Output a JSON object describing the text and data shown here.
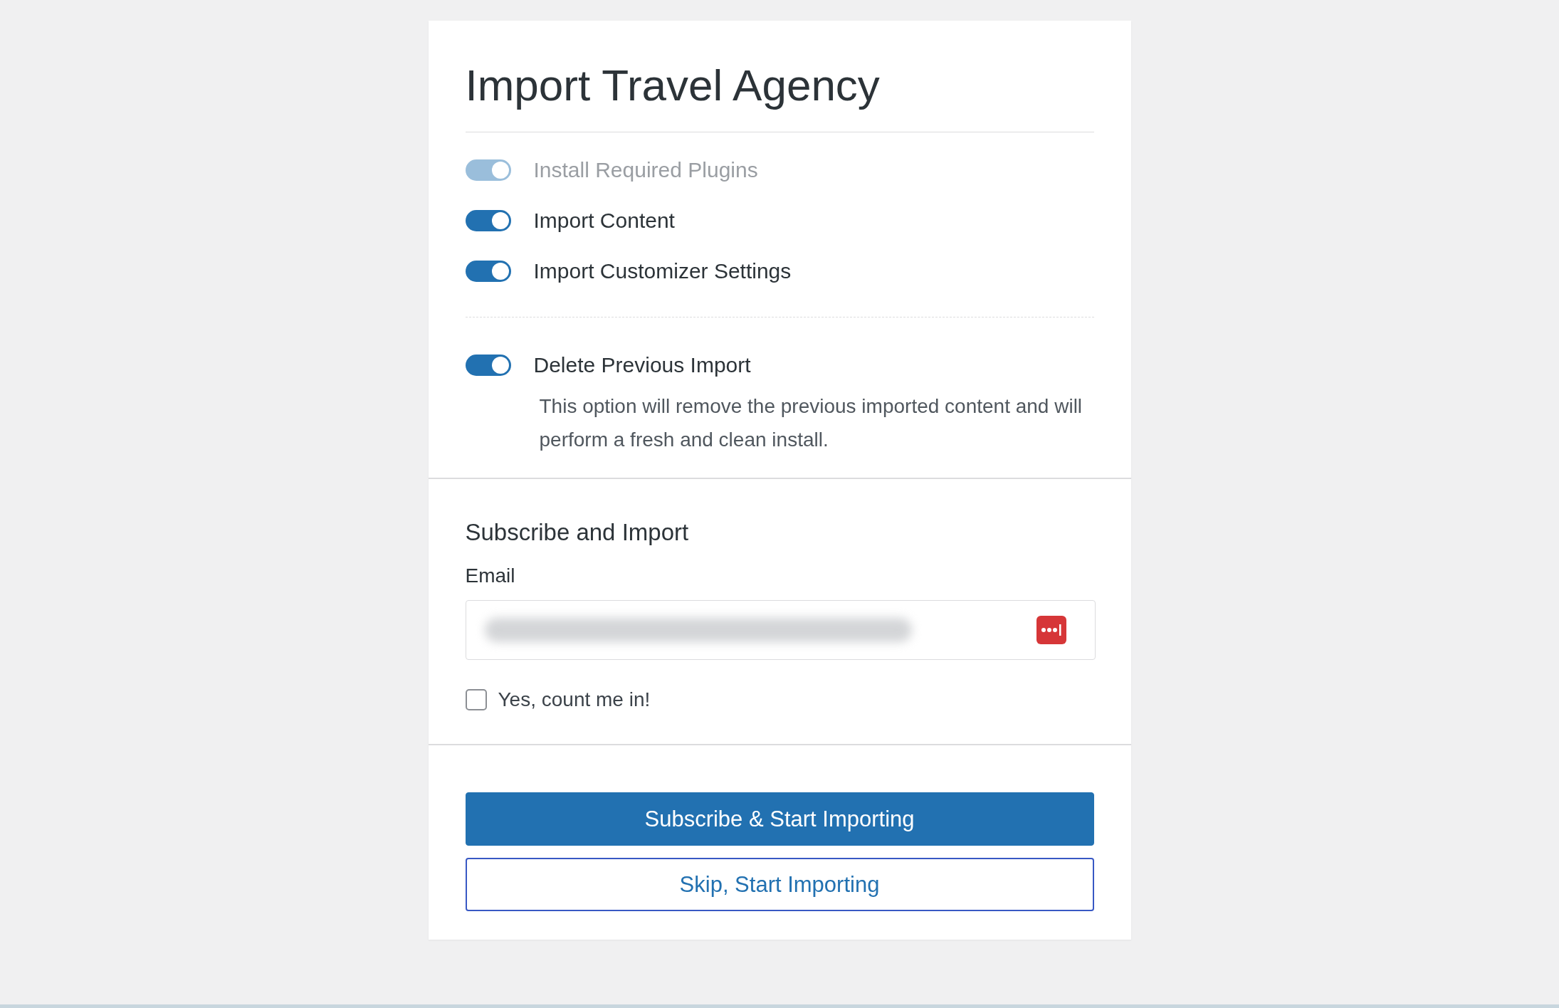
{
  "title": "Import Travel Agency",
  "options": [
    {
      "label": "Install Required Plugins",
      "on": true,
      "disabled": true
    },
    {
      "label": "Import Content",
      "on": true,
      "disabled": false
    },
    {
      "label": "Import Customizer Settings",
      "on": true,
      "disabled": false
    }
  ],
  "delete_option": {
    "label": "Delete Previous Import",
    "on": true,
    "disabled": false,
    "description": "This option will remove the previous imported content and will perform a fresh and clean install."
  },
  "subscribe": {
    "heading": "Subscribe and Import",
    "email_label": "Email",
    "email_value_redacted": true,
    "consent": {
      "label": "Yes, count me in!",
      "checked": false
    }
  },
  "buttons": [
    {
      "label": "Subscribe & Start Importing",
      "kind": "primary"
    },
    {
      "label": "Skip, Start Importing",
      "kind": "secondary"
    }
  ]
}
